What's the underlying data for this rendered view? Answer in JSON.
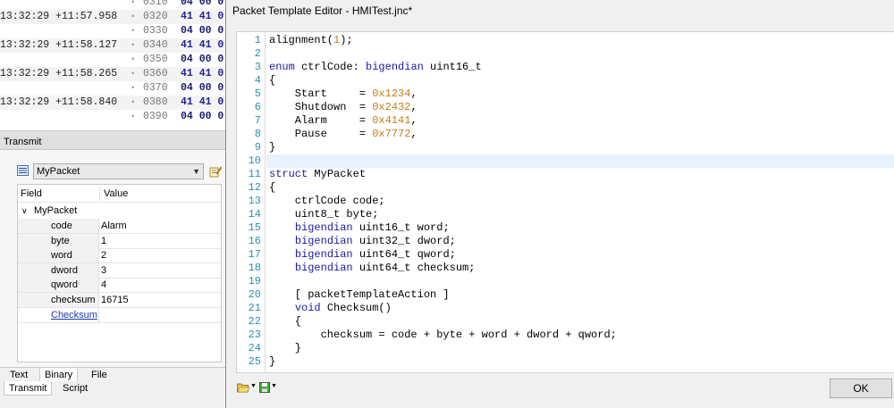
{
  "hex_log": {
    "rows": [
      {
        "timestamp": "",
        "offset": "0310",
        "bytes": "04 00 0",
        "color": "navy"
      },
      {
        "timestamp": "13:32:29 +11:57.958",
        "offset": "0320",
        "bytes": "41 41 0",
        "color": "blue"
      },
      {
        "timestamp": "",
        "offset": "0330",
        "bytes": "04 00 0",
        "color": "navy"
      },
      {
        "timestamp": "13:32:29 +11:58.127",
        "offset": "0340",
        "bytes": "41 41 0",
        "color": "blue"
      },
      {
        "timestamp": "",
        "offset": "0350",
        "bytes": "04 00 0",
        "color": "navy"
      },
      {
        "timestamp": "13:32:29 +11:58.265",
        "offset": "0360",
        "bytes": "41 41 0",
        "color": "blue"
      },
      {
        "timestamp": "",
        "offset": "0370",
        "bytes": "04 00 0",
        "color": "navy"
      },
      {
        "timestamp": "13:32:29 +11:58.840",
        "offset": "0380",
        "bytes": "41 41 0",
        "color": "blue"
      },
      {
        "timestamp": "",
        "offset": "0390",
        "bytes": "04 00 0",
        "color": "navy"
      }
    ]
  },
  "transmit": {
    "title": "Transmit",
    "packet_select": "MyPacket",
    "grid": {
      "headers": {
        "field": "Field",
        "value": "Value"
      },
      "group": "MyPacket",
      "rows": [
        {
          "field": "code",
          "value": "Alarm"
        },
        {
          "field": "byte",
          "value": "1"
        },
        {
          "field": "word",
          "value": "2"
        },
        {
          "field": "dword",
          "value": "3"
        },
        {
          "field": "qword",
          "value": "4"
        },
        {
          "field": "checksum",
          "value": "16715"
        }
      ],
      "action": "Checksum"
    },
    "tabs_top": [
      "Text",
      "Binary",
      "File"
    ],
    "tabs_bottom": [
      "Transmit",
      "Script"
    ]
  },
  "dialog": {
    "title": "Packet Template Editor - HMITest.jnc*",
    "ok_label": "OK",
    "code_lines": [
      {
        "n": "1",
        "parts": [
          [
            "",
            "alignment("
          ],
          [
            "num",
            "1"
          ],
          [
            "",
            ");"
          ]
        ]
      },
      {
        "n": "2",
        "parts": [
          [
            "",
            ""
          ]
        ]
      },
      {
        "n": "3",
        "parts": [
          [
            "kw",
            "enum"
          ],
          [
            "",
            " ctrlCode: "
          ],
          [
            "kw",
            "bigendian"
          ],
          [
            "",
            " uint16_t"
          ]
        ]
      },
      {
        "n": "4",
        "parts": [
          [
            "",
            "{"
          ]
        ]
      },
      {
        "n": "5",
        "parts": [
          [
            "",
            "    Start     = "
          ],
          [
            "num",
            "0x1234"
          ],
          [
            "",
            ","
          ]
        ]
      },
      {
        "n": "6",
        "parts": [
          [
            "",
            "    Shutdown  = "
          ],
          [
            "num",
            "0x2432"
          ],
          [
            "",
            ","
          ]
        ]
      },
      {
        "n": "7",
        "parts": [
          [
            "",
            "    Alarm     = "
          ],
          [
            "num",
            "0x4141"
          ],
          [
            "",
            ","
          ]
        ]
      },
      {
        "n": "8",
        "parts": [
          [
            "",
            "    Pause     = "
          ],
          [
            "num",
            "0x7772"
          ],
          [
            "",
            ","
          ]
        ]
      },
      {
        "n": "9",
        "parts": [
          [
            "",
            "}"
          ]
        ]
      },
      {
        "n": "10",
        "parts": [
          [
            "",
            ""
          ]
        ]
      },
      {
        "n": "11",
        "parts": [
          [
            "kw",
            "struct"
          ],
          [
            "",
            " MyPacket"
          ]
        ]
      },
      {
        "n": "12",
        "parts": [
          [
            "",
            "{"
          ]
        ]
      },
      {
        "n": "13",
        "parts": [
          [
            "",
            "    ctrlCode code;"
          ]
        ]
      },
      {
        "n": "14",
        "parts": [
          [
            "",
            "    uint8_t byte;"
          ]
        ]
      },
      {
        "n": "15",
        "parts": [
          [
            "",
            "    "
          ],
          [
            "kw",
            "bigendian"
          ],
          [
            "",
            " uint16_t word;"
          ]
        ]
      },
      {
        "n": "16",
        "parts": [
          [
            "",
            "    "
          ],
          [
            "kw",
            "bigendian"
          ],
          [
            "",
            " uint32_t dword;"
          ]
        ]
      },
      {
        "n": "17",
        "parts": [
          [
            "",
            "    "
          ],
          [
            "kw",
            "bigendian"
          ],
          [
            "",
            " uint64_t qword;"
          ]
        ]
      },
      {
        "n": "18",
        "parts": [
          [
            "",
            "    "
          ],
          [
            "kw",
            "bigendian"
          ],
          [
            "",
            " uint64_t checksum;"
          ]
        ]
      },
      {
        "n": "19",
        "parts": [
          [
            "",
            ""
          ]
        ]
      },
      {
        "n": "20",
        "parts": [
          [
            "",
            "    [ packetTemplateAction ]"
          ]
        ]
      },
      {
        "n": "21",
        "parts": [
          [
            "",
            "    "
          ],
          [
            "kw",
            "void"
          ],
          [
            "",
            " Checksum()"
          ]
        ]
      },
      {
        "n": "22",
        "parts": [
          [
            "",
            "    {"
          ]
        ]
      },
      {
        "n": "23",
        "parts": [
          [
            "",
            "        checksum = code + byte + word + dword + qword;"
          ]
        ]
      },
      {
        "n": "24",
        "parts": [
          [
            "",
            "    }"
          ]
        ]
      },
      {
        "n": "25",
        "parts": [
          [
            "",
            "}"
          ]
        ]
      }
    ],
    "current_line": "10"
  },
  "colors": {
    "keyword": "#1a1aa6",
    "number": "#c87d1c",
    "line_number": "#2b91af",
    "link": "#1c3aa9"
  }
}
